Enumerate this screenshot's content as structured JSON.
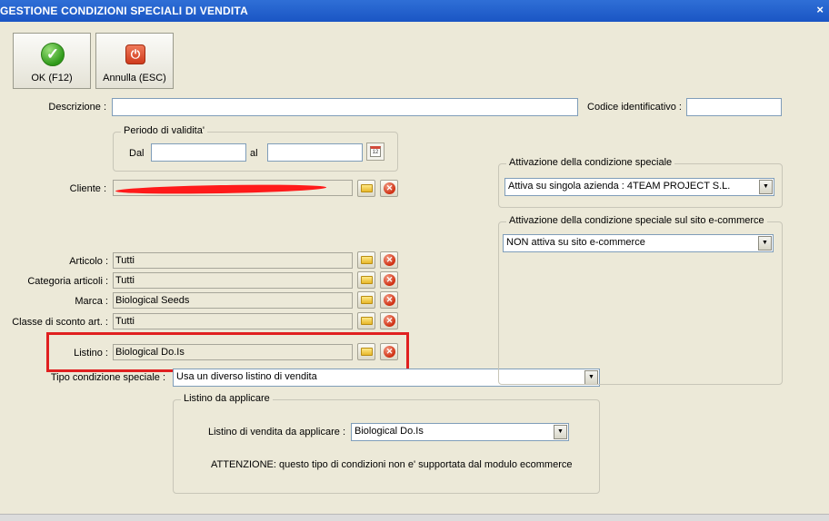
{
  "window": {
    "title": "GESTIONE CONDIZIONI SPECIALI DI VENDITA",
    "close_glyph": "×"
  },
  "toolbar": {
    "ok_label": "OK (F12)",
    "cancel_label": "Annulla (ESC)"
  },
  "form": {
    "descrizione_label": "Descrizione :",
    "descrizione_value": "",
    "codice_label": "Codice identificativo :",
    "codice_value": "",
    "periodo_title": "Periodo di validita'",
    "dal_label": "Dal",
    "dal_value": "",
    "al_label": "al",
    "al_value": "",
    "cliente_label": "Cliente :",
    "cliente_value": "",
    "articolo_label": "Articolo :",
    "articolo_value": "Tutti",
    "categoria_label": "Categoria articoli :",
    "categoria_value": "Tutti",
    "marca_label": "Marca :",
    "marca_value": "Biological Seeds",
    "classe_label": "Classe di sconto art. :",
    "classe_value": "Tutti",
    "listino_label": "Listino :",
    "listino_value": "Biological Do.Is",
    "tipo_label": "Tipo condizione speciale :",
    "tipo_value": "Usa un diverso listino di vendita"
  },
  "attivazione": {
    "title": "Attivazione della condizione speciale",
    "value": "Attiva su singola azienda : 4TEAM PROJECT S.L."
  },
  "attivazione_ecommerce": {
    "title": "Attivazione della condizione speciale sul sito e-commerce",
    "value": "NON attiva su sito e-commerce"
  },
  "listino_applicare": {
    "title": "Listino da applicare",
    "label": "Listino di vendita da applicare :",
    "value": "Biological Do.Is",
    "warning": "ATTENZIONE: questo tipo di condizioni non e' supportata dal modulo ecommerce"
  },
  "icons": {
    "ok": "check-icon",
    "cancel": "power-icon",
    "folder": "folder-icon",
    "delete": "delete-icon",
    "calendar": "calendar-icon",
    "dropdown": "chevron-down-icon"
  },
  "colors": {
    "titlebar": "#1a55c4",
    "highlight": "#e02020",
    "dialog_bg": "#ece9d8"
  }
}
